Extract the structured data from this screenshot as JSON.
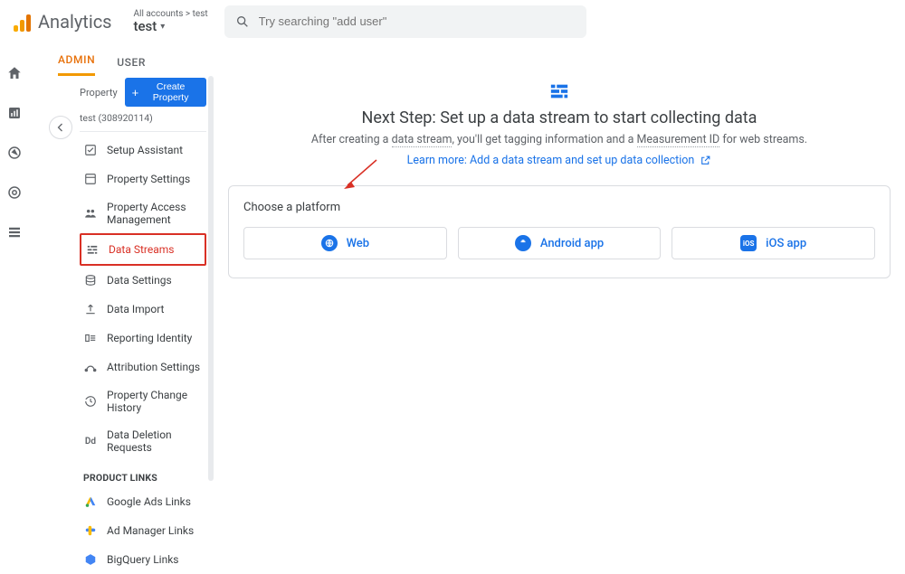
{
  "brand": "Analytics",
  "breadcrumb": "All accounts > test",
  "property_name": "test",
  "search_placeholder": "Try searching \"add user\"",
  "tabs": {
    "admin": "ADMIN",
    "user": "USER"
  },
  "side": {
    "label": "Property",
    "create_btn": "Create Property",
    "propid": "test (308920114)",
    "items": [
      "Setup Assistant",
      "Property Settings",
      "Property Access Management",
      "Data Streams",
      "Data Settings",
      "Data Import",
      "Reporting Identity",
      "Attribution Settings",
      "Property Change History",
      "Data Deletion Requests"
    ],
    "product_links_title": "PRODUCT LINKS",
    "product_links": [
      "Google Ads Links",
      "Ad Manager Links",
      "BigQuery Links"
    ]
  },
  "hero": {
    "title": "Next Step: Set up a data stream to start collecting data",
    "prefix": "After creating a ",
    "term1": "data stream",
    "mid": ", you'll get tagging information and a ",
    "term2": "Measurement ID",
    "suffix": " for web streams.",
    "learn": "Learn more: Add a data stream and set up data collection"
  },
  "card": {
    "title": "Choose a platform",
    "web": "Web",
    "android": "Android app",
    "ios": "iOS app"
  }
}
